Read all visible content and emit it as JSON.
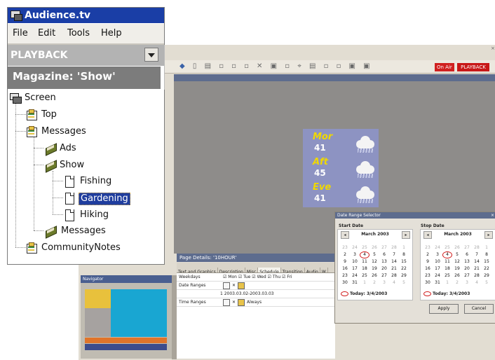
{
  "app": {
    "title": "Audience.tv"
  },
  "menu": [
    "File",
    "Edit",
    "Tools",
    "Help"
  ],
  "mode_select": {
    "value": "PLAYBACK"
  },
  "magazine": {
    "label": "Magazine: 'Show'"
  },
  "tree": {
    "root": "Screen",
    "top": "Top",
    "messages": "Messages",
    "ads": "Ads",
    "show": "Show",
    "fishing": "Fishing",
    "gardening": "Gardening",
    "hiking": "Hiking",
    "messages2": "Messages",
    "community": "CommunityNotes"
  },
  "editor": {
    "on_air": "On Air",
    "playback": "PLAYBACK"
  },
  "weather": [
    {
      "label": "Mor",
      "value": "41",
      "icon": "rain-cloud-icon"
    },
    {
      "label": "Aft",
      "value": "45",
      "icon": "rain-cloud-icon"
    },
    {
      "label": "Eve",
      "value": "41",
      "icon": "rain-cloud-icon"
    }
  ],
  "page_details": {
    "title": "Page Details: '10HOUR'",
    "tabs": [
      "Text and Graphics",
      "Description",
      "Misc",
      "Schedule",
      "Transition",
      "Audio",
      "W"
    ],
    "weekdays_label": "Weekdays",
    "weekdays_value": "☑ Mon  ☑ Tue  ☑ Wed  ☑ Thu  ☑ Fri",
    "date_ranges_label": "Date Ranges",
    "date_range_value": "1 2003.03.02-2003.03.03",
    "time_ranges_label": "Time Ranges",
    "time_always": "Always"
  },
  "navigator": {
    "title": "Navigator"
  },
  "date_range_selector": {
    "title": "Date Range Selector",
    "start_label": "Start Date",
    "stop_label": "Stop Date",
    "month": "March 2003",
    "today": "Today: 3/4/2003",
    "apply": "Apply",
    "cancel": "Cancel",
    "weeks": [
      [
        "23",
        "24",
        "25",
        "26",
        "27",
        "28",
        "1"
      ],
      [
        "2",
        "3",
        "4",
        "5",
        "6",
        "7",
        "8"
      ],
      [
        "9",
        "10",
        "11",
        "12",
        "13",
        "14",
        "15"
      ],
      [
        "16",
        "17",
        "18",
        "19",
        "20",
        "21",
        "22"
      ],
      [
        "23",
        "24",
        "25",
        "26",
        "27",
        "28",
        "29"
      ],
      [
        "30",
        "31",
        "1",
        "2",
        "3",
        "4",
        "5"
      ]
    ],
    "circled_day": "4"
  }
}
